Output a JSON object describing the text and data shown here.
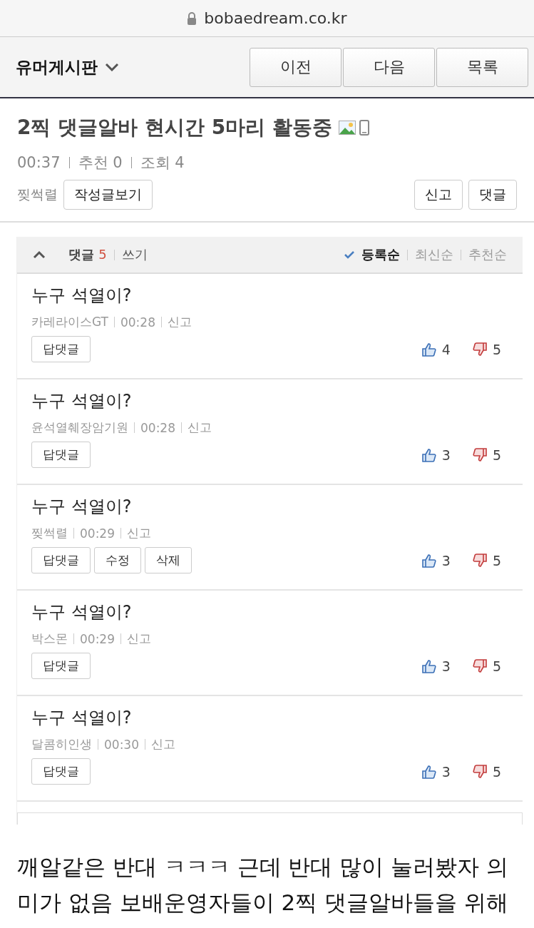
{
  "address_bar": {
    "url": "bobaedream.co.kr"
  },
  "header": {
    "board": "유머게시판",
    "nav_buttons": [
      "이전",
      "다음",
      "목록"
    ]
  },
  "post": {
    "title": "2찍 댓글알바 현시간 5마리 활동중",
    "has_image": true,
    "from_mobile": true,
    "time": "00:37",
    "recommend_label": "추천",
    "recommend": "0",
    "views_label": "조회",
    "views": "4",
    "author": "찢썩렬",
    "author_button": "작성글보기",
    "actions": [
      "신고",
      "댓글"
    ]
  },
  "comments_bar": {
    "expanded": true,
    "label": "댓글",
    "count": "5",
    "write": "쓰기",
    "sort": [
      {
        "label": "등록순",
        "selected": true
      },
      {
        "label": "최신순",
        "selected": false
      },
      {
        "label": "추천순",
        "selected": false
      }
    ]
  },
  "comments": [
    {
      "text": "누구 석열이?",
      "author": "카레라이스GT",
      "time": "00:28",
      "report": "신고",
      "buttons": [
        "답댓글"
      ],
      "up": "4",
      "down": "5"
    },
    {
      "text": "누구 석열이?",
      "author": "윤석열췌장암기원",
      "time": "00:28",
      "report": "신고",
      "buttons": [
        "답댓글"
      ],
      "up": "3",
      "down": "5"
    },
    {
      "text": "누구 석열이?",
      "author": "찢썩렬",
      "time": "00:29",
      "report": "신고",
      "buttons": [
        "답댓글",
        "수정",
        "삭제"
      ],
      "up": "3",
      "down": "5"
    },
    {
      "text": "누구 석열이?",
      "author": "박스몬",
      "time": "00:29",
      "report": "신고",
      "buttons": [
        "답댓글"
      ],
      "up": "3",
      "down": "5"
    },
    {
      "text": "누구 석열이?",
      "author": "달콤히인생",
      "time": "00:30",
      "report": "신고",
      "buttons": [
        "답댓글"
      ],
      "up": "3",
      "down": "5"
    }
  ],
  "caption": {
    "lines": [
      "깨알같은 반대 ㅋㅋㅋ 근데 반대 많이 눌러봤자 의",
      "미가 없음 보배운영자들이 2찍 댓글알바들을 위해"
    ]
  }
}
